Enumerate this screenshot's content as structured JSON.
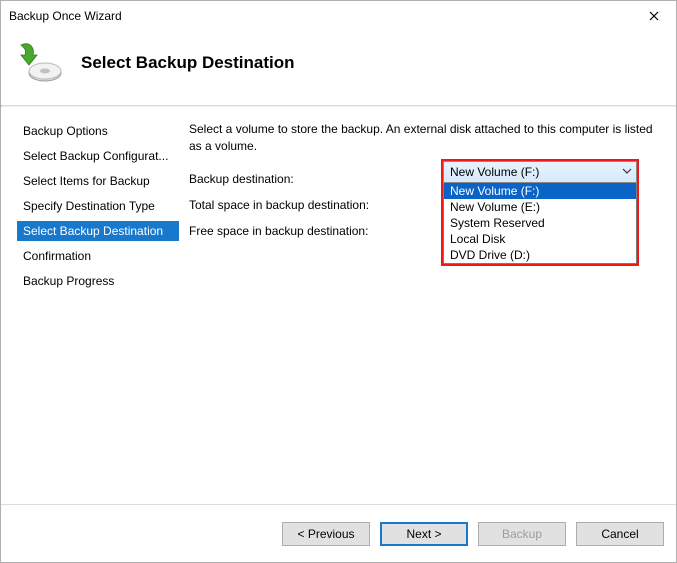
{
  "window": {
    "title": "Backup Once Wizard"
  },
  "header": {
    "title": "Select Backup Destination"
  },
  "sidebar": {
    "items": [
      {
        "label": "Backup Options"
      },
      {
        "label": "Select Backup Configurat..."
      },
      {
        "label": "Select Items for Backup"
      },
      {
        "label": "Specify Destination Type"
      },
      {
        "label": "Select Backup Destination"
      },
      {
        "label": "Confirmation"
      },
      {
        "label": "Backup Progress"
      }
    ],
    "active_index": 4
  },
  "main": {
    "description": "Select a volume to store the backup. An external disk attached to this computer is listed as a volume.",
    "dest_label": "Backup destination:",
    "total_label": "Total space in backup destination:",
    "free_label": "Free space in backup destination:",
    "combo": {
      "selected": "New Volume (F:)",
      "options": [
        "New Volume (F:)",
        "New Volume (E:)",
        "System Reserved",
        "Local Disk",
        "DVD Drive (D:)"
      ],
      "highlight_index": 0
    }
  },
  "footer": {
    "prev": "< Previous",
    "next": "Next >",
    "backup": "Backup",
    "cancel": "Cancel"
  }
}
